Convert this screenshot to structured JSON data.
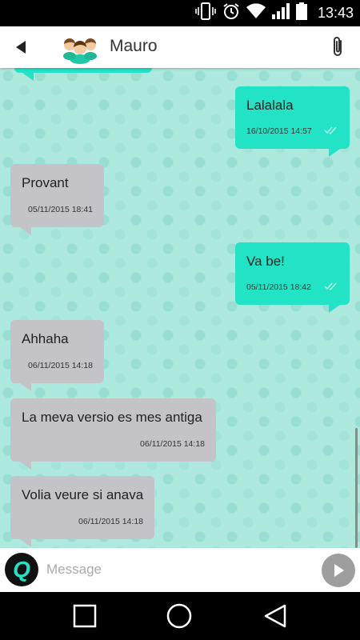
{
  "status_bar": {
    "time": "13:43"
  },
  "header": {
    "contact_name": "Mauro"
  },
  "messages": [
    {
      "direction": "sent",
      "text": "Lalalala",
      "timestamp": "16/10/2015 14:57",
      "status": "read"
    },
    {
      "direction": "received",
      "text": "Provant",
      "timestamp": "05/11/2015 18:41"
    },
    {
      "direction": "sent",
      "text": "Va be!",
      "timestamp": "05/11/2015 18:42",
      "status": "read"
    },
    {
      "direction": "received",
      "text": "Ahhaha",
      "timestamp": "06/11/2015 14:18"
    },
    {
      "direction": "received",
      "text": "La meva versio es mes antiga",
      "timestamp": "06/11/2015 14:18"
    },
    {
      "direction": "received",
      "text": "Volia veure si anava",
      "timestamp": "06/11/2015 14:18"
    }
  ],
  "composer": {
    "placeholder": "Message",
    "logo_letter": "Q"
  },
  "colors": {
    "sent_bubble": "#22e3c6",
    "received_bubble": "#c3c3c8",
    "chat_background": "#aee9de"
  }
}
